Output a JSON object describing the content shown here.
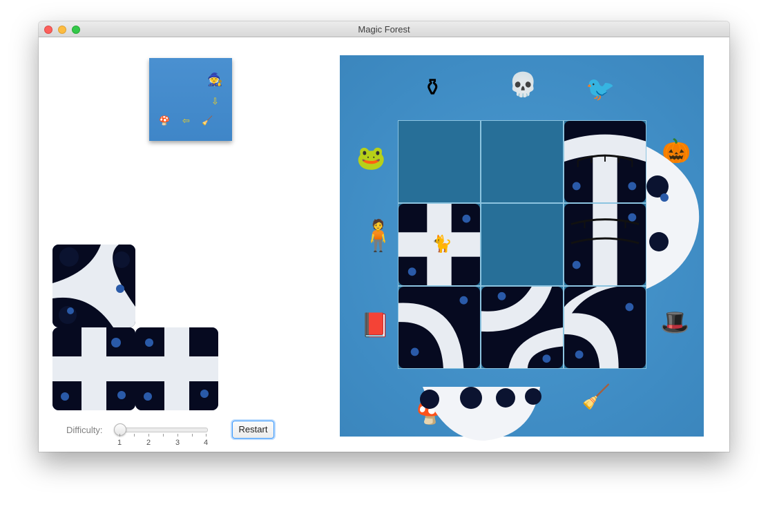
{
  "window": {
    "title": "Magic Forest"
  },
  "goal_preview": {
    "items": [
      {
        "name": "witch-hat-icon",
        "glyph": "🧙"
      },
      {
        "name": "down-arrow-icon",
        "glyph": "⇩"
      },
      {
        "name": "broom-icon",
        "glyph": "🧹"
      },
      {
        "name": "left-arrow-icon",
        "glyph": "⇦"
      },
      {
        "name": "mushrooms-icon",
        "glyph": "🍄"
      }
    ]
  },
  "board": {
    "decorations": [
      {
        "name": "cauldron-icon",
        "glyph": "⚱"
      },
      {
        "name": "skeleton-icon",
        "glyph": "💀"
      },
      {
        "name": "raven-icon",
        "glyph": "🐦"
      },
      {
        "name": "frog-icon",
        "glyph": "🐸"
      },
      {
        "name": "pumpkin-icon",
        "glyph": "🎃"
      },
      {
        "name": "scarecrow-icon",
        "glyph": "🧍"
      },
      {
        "name": "spell-book-icon",
        "glyph": "📕"
      },
      {
        "name": "witch-hat-icon",
        "glyph": "🎩"
      },
      {
        "name": "mushrooms-icon",
        "glyph": "🍄"
      },
      {
        "name": "broom-icon",
        "glyph": "🧹"
      },
      {
        "name": "black-cat-icon",
        "glyph": "🐈"
      }
    ]
  },
  "controls": {
    "difficulty_label": "Difficulty:",
    "difficulty_value": 1,
    "difficulty_ticks": [
      "1",
      "2",
      "3",
      "4"
    ],
    "restart_label": "Restart"
  },
  "colors": {
    "board_blue": "#3f8cc4",
    "slot_blue": "#276f98",
    "path_white": "#e8ecf2",
    "tree_dark": "#060a20"
  }
}
